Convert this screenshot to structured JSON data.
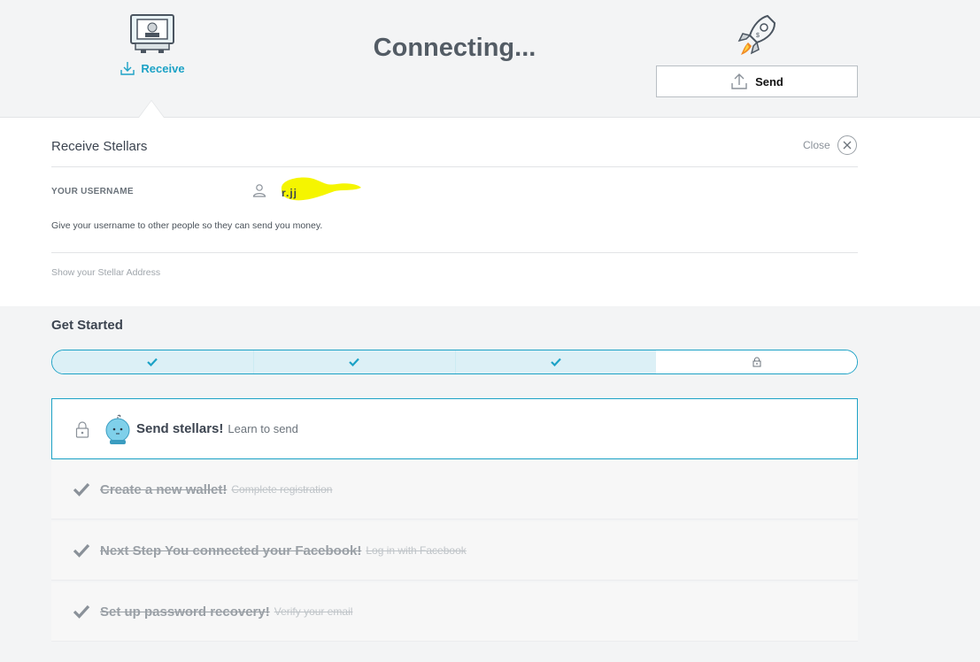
{
  "header": {
    "title": "Connecting...",
    "receive_label": "Receive",
    "send_label": "Send"
  },
  "receive_panel": {
    "title": "Receive Stellars",
    "close_label": "Close",
    "username_label": "YOUR USERNAME",
    "username_value": "r.jj",
    "help_text": "Give your username to other people so they can send you money.",
    "show_address_link": "Show your Stellar Address"
  },
  "get_started": {
    "title": "Get Started",
    "progress": {
      "completed": 3,
      "total": 4
    },
    "active_step": {
      "title": "Send stellars!",
      "subtitle": "Learn to send"
    },
    "completed_steps": [
      {
        "title": "Create a new wallet!",
        "subtitle": "Complete registration"
      },
      {
        "title": "Next Step You connected your Facebook!",
        "subtitle": "Log in with Facebook"
      },
      {
        "title": "Set up password recovery!",
        "subtitle": "Verify your email"
      }
    ]
  },
  "colors": {
    "accent": "#1ca2c6",
    "title_text": "#535c65",
    "highlight": "#f5f500",
    "rocket_flame": "#f08a24"
  }
}
